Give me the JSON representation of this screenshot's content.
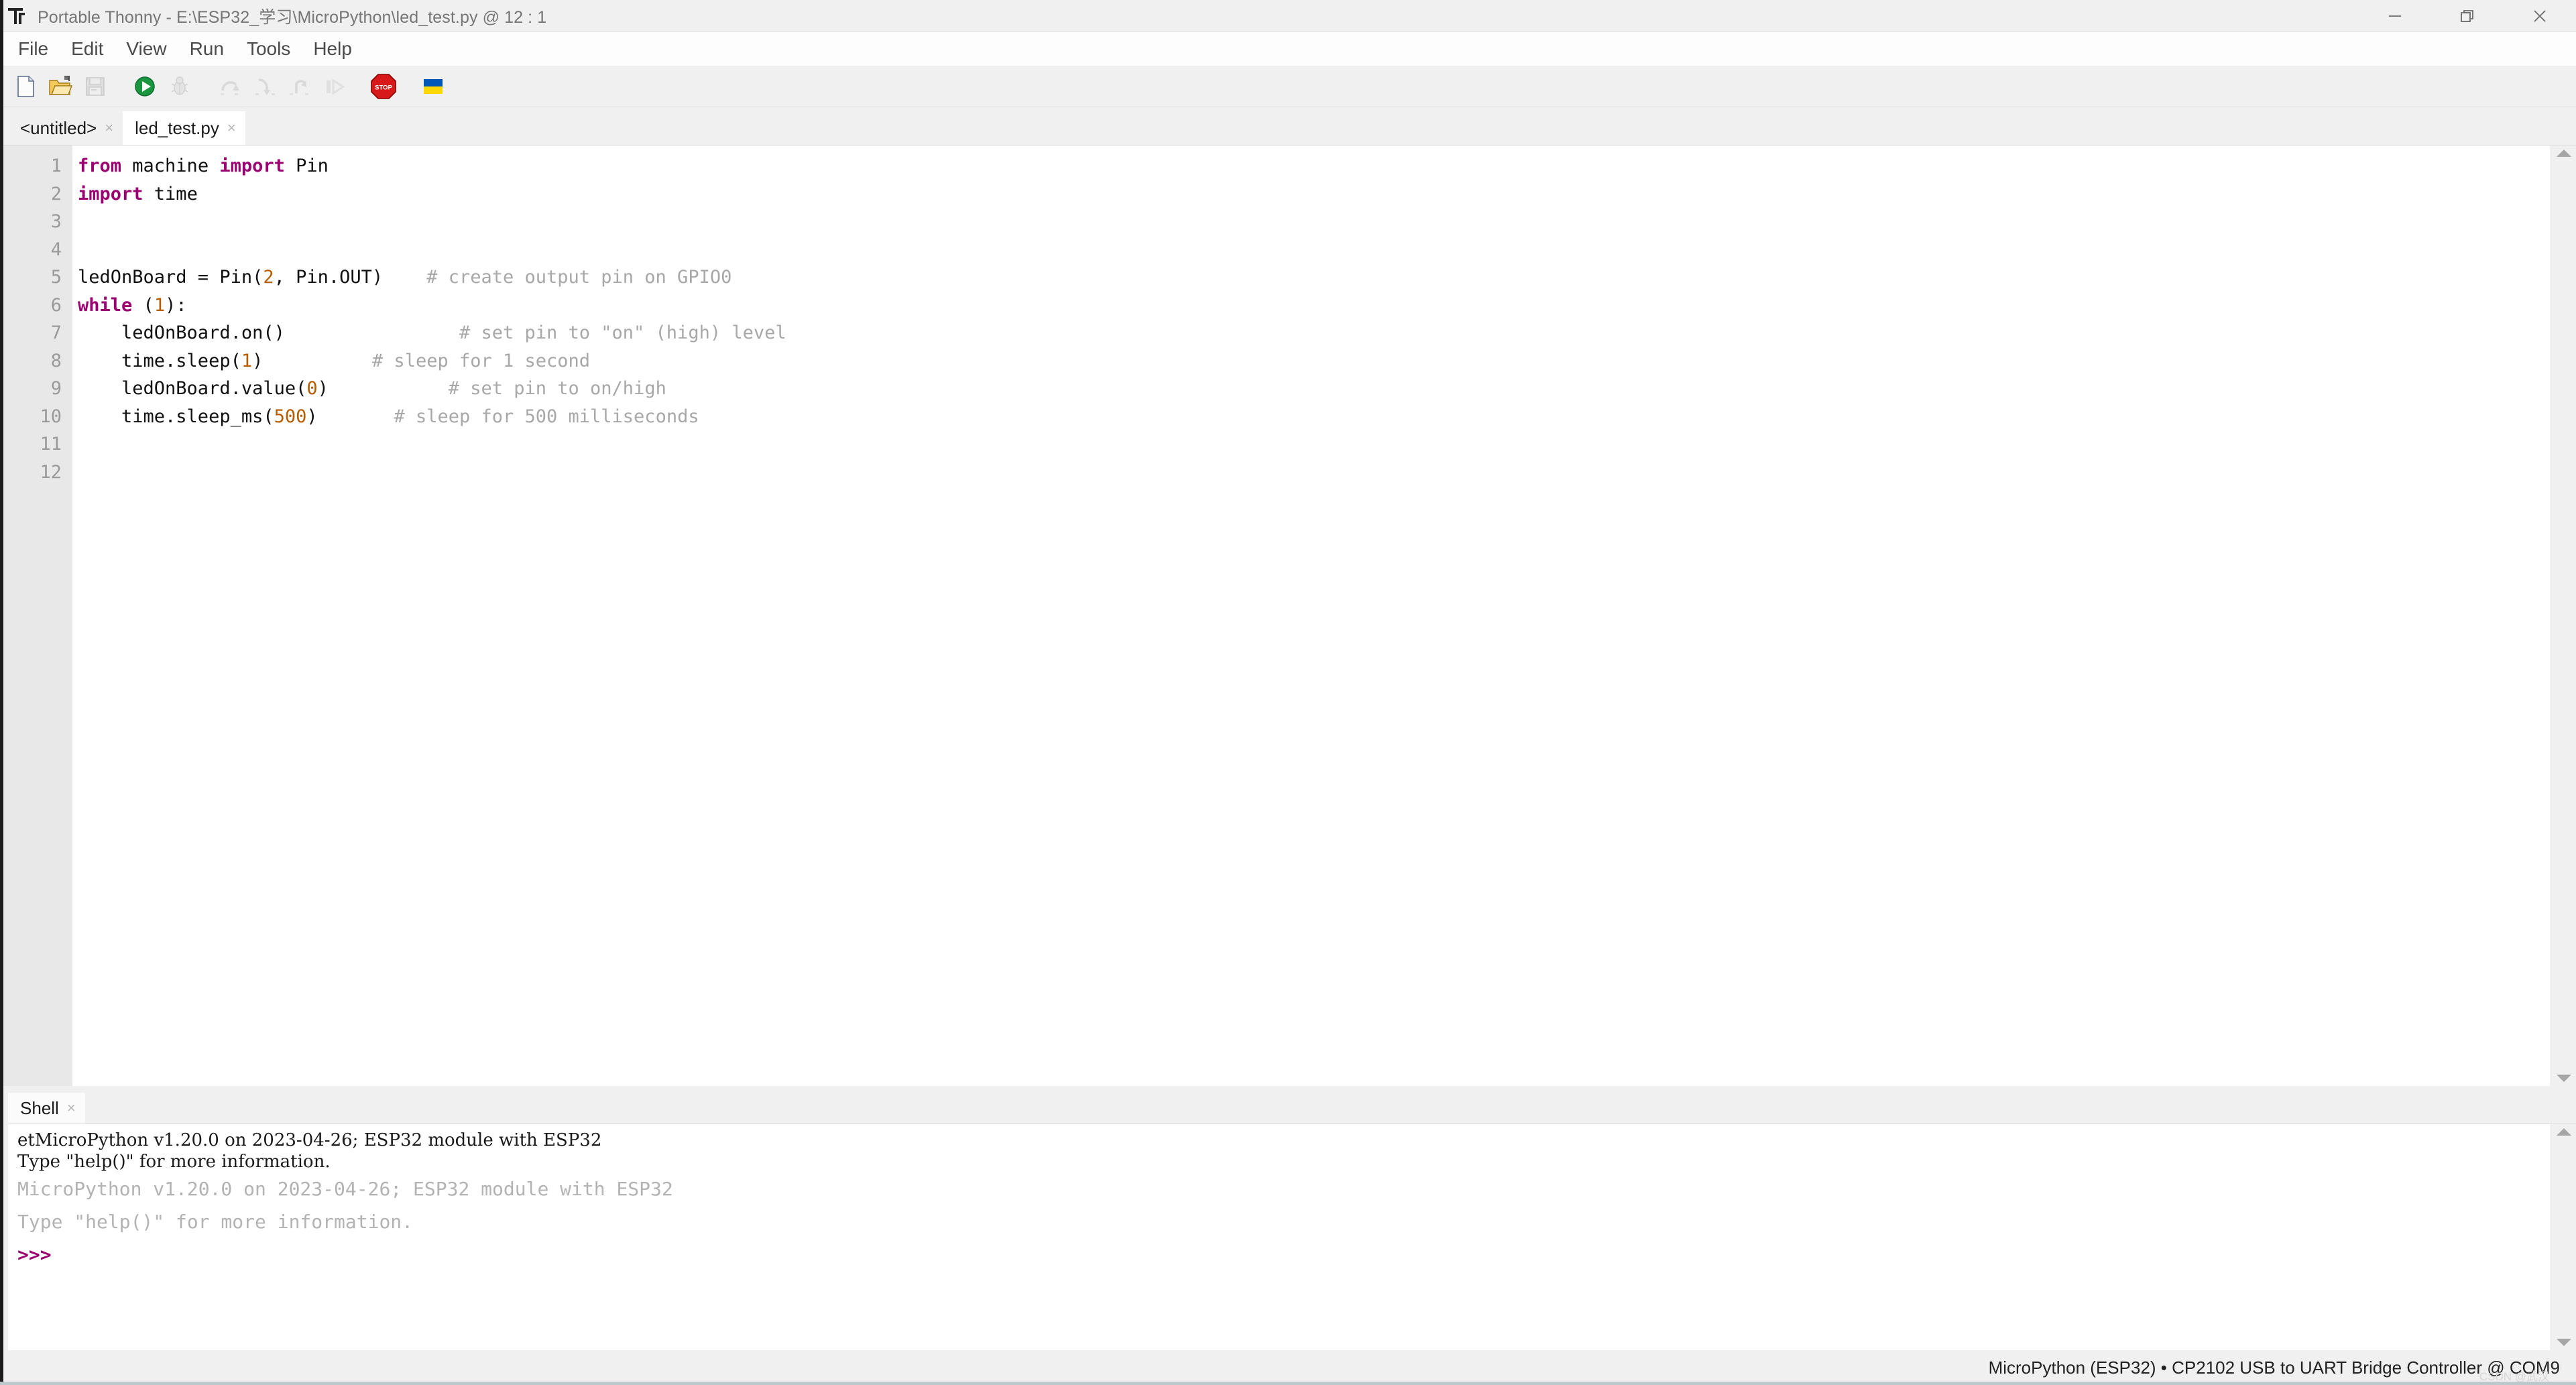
{
  "window": {
    "title": "Portable Thonny  -  E:\\ESP32_学习\\MicroPython\\led_test.py  @  12 : 1",
    "app_icon": "thonny-logo-icon",
    "controls": {
      "minimize": "minimize-icon",
      "restore": "restore-icon",
      "close": "close-icon"
    }
  },
  "menubar": {
    "items": [
      {
        "label": "File"
      },
      {
        "label": "Edit"
      },
      {
        "label": "View"
      },
      {
        "label": "Run"
      },
      {
        "label": "Tools"
      },
      {
        "label": "Help"
      }
    ]
  },
  "toolbar": {
    "buttons": [
      {
        "name": "new-file-icon",
        "title": "New",
        "enabled": true
      },
      {
        "name": "open-file-icon",
        "title": "Load",
        "enabled": true
      },
      {
        "name": "save-file-icon",
        "title": "Save",
        "enabled": false
      },
      {
        "name": "run-icon",
        "title": "Run current script",
        "enabled": true
      },
      {
        "name": "debug-icon",
        "title": "Debug current script",
        "enabled": false
      },
      {
        "name": "step-over-icon",
        "title": "Step over",
        "enabled": false
      },
      {
        "name": "step-into-icon",
        "title": "Step into",
        "enabled": false
      },
      {
        "name": "step-out-icon",
        "title": "Step out",
        "enabled": false
      },
      {
        "name": "resume-icon",
        "title": "Resume",
        "enabled": false
      },
      {
        "name": "stop-icon",
        "title": "Stop/Restart backend",
        "enabled": true,
        "label": "STOP"
      },
      {
        "name": "ukraine-flag-icon",
        "title": "Support Ukraine",
        "enabled": true
      }
    ]
  },
  "editor": {
    "tabs": [
      {
        "label": "<untitled>",
        "active": false,
        "close": "×"
      },
      {
        "label": "led_test.py",
        "active": true,
        "close": "×"
      }
    ],
    "line_numbers": [
      "1",
      "2",
      "3",
      "4",
      "5",
      "6",
      "7",
      "8",
      "9",
      "10",
      "11",
      "12"
    ],
    "lines": [
      {
        "n": 1,
        "segments": [
          {
            "t": "from ",
            "c": "kw"
          },
          {
            "t": "machine ",
            "c": ""
          },
          {
            "t": "import ",
            "c": "kw"
          },
          {
            "t": "Pin",
            "c": ""
          }
        ]
      },
      {
        "n": 2,
        "segments": [
          {
            "t": "import ",
            "c": "kw"
          },
          {
            "t": "time",
            "c": ""
          }
        ]
      },
      {
        "n": 3,
        "segments": [
          {
            "t": "",
            "c": ""
          }
        ]
      },
      {
        "n": 4,
        "segments": [
          {
            "t": "",
            "c": ""
          }
        ]
      },
      {
        "n": 5,
        "segments": [
          {
            "t": "ledOnBoard = Pin(",
            "c": ""
          },
          {
            "t": "2",
            "c": "num"
          },
          {
            "t": ", Pin.OUT)    ",
            "c": ""
          },
          {
            "t": "# create output pin on GPIO0",
            "c": "cmt"
          }
        ]
      },
      {
        "n": 6,
        "segments": [
          {
            "t": "while ",
            "c": "kw"
          },
          {
            "t": "(",
            "c": ""
          },
          {
            "t": "1",
            "c": "num"
          },
          {
            "t": "):",
            "c": ""
          }
        ]
      },
      {
        "n": 7,
        "segments": [
          {
            "t": "    ledOnBoard.on()                ",
            "c": ""
          },
          {
            "t": "# set pin to \"on\" (high) level",
            "c": "cmt"
          }
        ]
      },
      {
        "n": 8,
        "segments": [
          {
            "t": "    time.sleep(",
            "c": ""
          },
          {
            "t": "1",
            "c": "num"
          },
          {
            "t": ")          ",
            "c": ""
          },
          {
            "t": "# sleep for 1 second",
            "c": "cmt"
          }
        ]
      },
      {
        "n": 9,
        "segments": [
          {
            "t": "    ledOnBoard.value(",
            "c": ""
          },
          {
            "t": "0",
            "c": "num"
          },
          {
            "t": ")           ",
            "c": ""
          },
          {
            "t": "# set pin to on/high",
            "c": "cmt"
          }
        ]
      },
      {
        "n": 10,
        "segments": [
          {
            "t": "    time.sleep_ms(",
            "c": ""
          },
          {
            "t": "500",
            "c": "num"
          },
          {
            "t": ")       ",
            "c": ""
          },
          {
            "t": "# sleep for 500 milliseconds",
            "c": "cmt"
          }
        ]
      },
      {
        "n": 11,
        "segments": [
          {
            "t": "",
            "c": ""
          }
        ]
      },
      {
        "n": 12,
        "segments": [
          {
            "t": "",
            "c": ""
          }
        ]
      }
    ],
    "scrollbar": {
      "up_arrow": "scroll-up-arrow-icon",
      "down_arrow": "scroll-down-arrow-icon"
    }
  },
  "shell": {
    "tab_label": "Shell",
    "tab_close": "×",
    "lines": [
      {
        "text": "etMicroPython v1.20.0 on 2023-04-26; ESP32 module with ESP32",
        "style": "small-dark"
      },
      {
        "text": "Type \"help()\" for more information.",
        "style": "small-dark"
      },
      {
        "text": "MicroPython v1.20.0 on 2023-04-26; ESP32 module with ESP32",
        "style": "large-gray"
      },
      {
        "text": "Type \"help()\" for more information.",
        "style": "large-gray"
      }
    ],
    "prompt": ">>>",
    "scrollbar": {
      "up_arrow": "scroll-up-arrow-icon",
      "down_arrow": "scroll-down-arrow-icon"
    }
  },
  "statusbar": {
    "text": "MicroPython (ESP32)  •  CP2102 USB to UART Bridge Controller @ COM9",
    "watermark": "CSDN @武汉"
  },
  "colors": {
    "keyword": "#9b0070",
    "number": "#b85c00",
    "comment": "#a8a8a8",
    "prompt": "#9b0070",
    "run_green": "#1a9641",
    "stop_red": "#cc1a1a",
    "flag_blue": "#0057b7",
    "flag_yellow": "#ffd700",
    "gutter_bg": "#e8e8e8",
    "chrome_bg": "#f0f0f0"
  }
}
